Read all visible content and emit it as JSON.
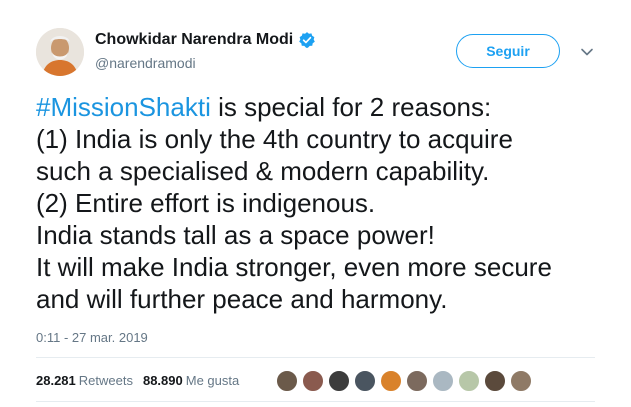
{
  "author": {
    "name": "Chowkidar Narendra Modi",
    "handle": "@narendramodi",
    "verified_icon": "verified-badge-icon",
    "avatar_icon": "profile-photo"
  },
  "follow_button": {
    "label": "Seguir"
  },
  "menu_icon": "chevron-down-icon",
  "tweet": {
    "hashtag": "#MissionShakti",
    "lines": [
      " is special for 2 reasons:",
      "(1) India is only the 4th country to acquire",
      "such a specialised & modern capability.",
      "(2) Entire effort is indigenous.",
      "India stands tall as a space power!",
      "It will make India stronger, even more secure",
      "and will further peace and harmony."
    ]
  },
  "timestamp": "0:11 - 27 mar. 2019",
  "stats": {
    "retweets_count": "28.281",
    "retweets_label": "Retweets",
    "likes_count": "88.890",
    "likes_label": "Me gusta"
  },
  "liker_avatars": [
    {
      "name": "liker-avatar-1",
      "color": "#6b5a4a"
    },
    {
      "name": "liker-avatar-2",
      "color": "#8a5a4e"
    },
    {
      "name": "liker-avatar-3",
      "color": "#3c3c3c"
    },
    {
      "name": "liker-avatar-4",
      "color": "#4a5560"
    },
    {
      "name": "liker-avatar-5",
      "color": "#d9822b"
    },
    {
      "name": "liker-avatar-6",
      "color": "#7c6a5e"
    },
    {
      "name": "liker-avatar-7",
      "color": "#aab8c2"
    },
    {
      "name": "liker-avatar-8",
      "color": "#b7c7a8"
    },
    {
      "name": "liker-avatar-9",
      "color": "#5b4a3c"
    },
    {
      "name": "liker-avatar-10",
      "color": "#8f7a66"
    }
  ],
  "colors": {
    "brand_blue": "#1da1f2",
    "link_blue": "#1b95e0",
    "text": "#14171a",
    "secondary_text": "#657786",
    "divider": "#e6ecf0"
  }
}
